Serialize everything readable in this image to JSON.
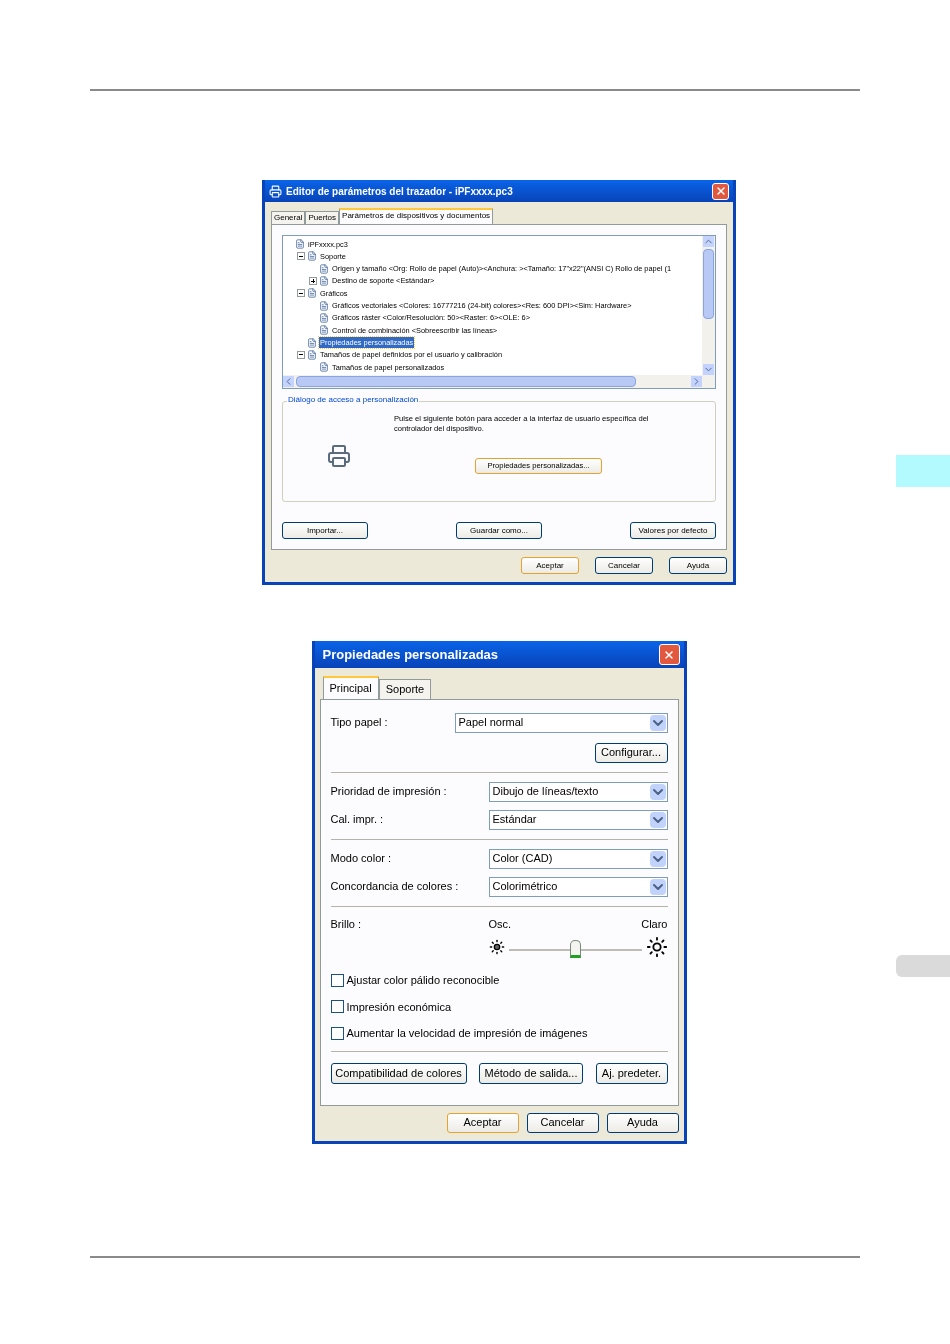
{
  "editor_dialog": {
    "title": "Editor de parámetros del trazador - iPFxxxx.pc3",
    "tabs": [
      {
        "label": "General",
        "selected": false
      },
      {
        "label": "Puertos",
        "selected": false
      },
      {
        "label": "Parámetros de dispositivos y documentos",
        "selected": true
      }
    ],
    "tree": [
      {
        "label": "iPFxxxx.pc3",
        "selected": false,
        "children": [
          {
            "label": "Soporte",
            "selected": false,
            "expanded": true,
            "children": [
              {
                "label": "Origen y tamaño <Org: Rollo de papel (Auto)><Anchura: ><Tamaño: 17\"x22\"(ANSI C) Rollo de papel (1",
                "selected": false
              },
              {
                "label": "Destino de soporte <Estándar>",
                "selected": false,
                "expanded": false
              }
            ]
          },
          {
            "label": "Gráficos",
            "selected": false,
            "expanded": true,
            "children": [
              {
                "label": "Gráficos vectoriales <Colores: 16777216 (24-bit) colores><Res: 600 DPI><Sim: Hardware>",
                "selected": false
              },
              {
                "label": "Gráficos ráster <Color/Resolución: 50><Raster: 6><OLE: 6>",
                "selected": false
              },
              {
                "label": "Control de combinación <Sobreescribir las líneas>",
                "selected": false
              }
            ]
          },
          {
            "label": "Propiedades personalizadas",
            "selected": true
          },
          {
            "label": "Tamaños de papel definidos por el usuario y calibración",
            "selected": false,
            "expanded": true,
            "children": [
              {
                "label": "Tamaños de papel personalizados",
                "selected": false
              }
            ]
          }
        ]
      }
    ],
    "group": {
      "title": "Diálogo de acceso a personalización",
      "text": "Pulse el siguiente botón para acceder a la interfaz de usuario específica del controlador del dispositivo.",
      "button": "Propiedades personalizadas..."
    },
    "buttons": [
      "Importar...",
      "Guardar como...",
      "Valores por defecto"
    ],
    "footer_buttons": [
      "Aceptar",
      "Cancelar",
      "Ayuda"
    ]
  },
  "custom_dialog": {
    "title": "Propiedades personalizadas",
    "tabs": [
      {
        "label": "Principal",
        "selected": true
      },
      {
        "label": "Soporte",
        "selected": false
      }
    ],
    "paper": {
      "label": "Tipo papel :",
      "value": "Papel normal"
    },
    "configure_button": "Configurar...",
    "select_groups": [
      [
        {
          "label": "Prioridad de impresión :",
          "value": "Dibujo de líneas/texto"
        },
        {
          "label": "Cal. impr. :",
          "value": "Estándar"
        }
      ],
      [
        {
          "label": "Modo color :",
          "value": "Color (CAD)"
        },
        {
          "label": "Concordancia de colores :",
          "value": "Colorimétrico"
        }
      ]
    ],
    "brightness": {
      "label": "Brillo :",
      "left_label": "Osc.",
      "right_label": "Claro",
      "level": 0.5
    },
    "checkboxes": [
      {
        "label": "Ajustar color pálido reconocible",
        "checked": false
      },
      {
        "label": "Impresión económica",
        "checked": false
      },
      {
        "label": "Aumentar la velocidad de impresión de imágenes",
        "checked": false
      }
    ],
    "buttons": [
      "Compatibilidad de colores",
      "Método de salida...",
      "Aj. predeter."
    ],
    "footer_buttons": [
      "Aceptar",
      "Cancelar",
      "Ayuda"
    ]
  }
}
